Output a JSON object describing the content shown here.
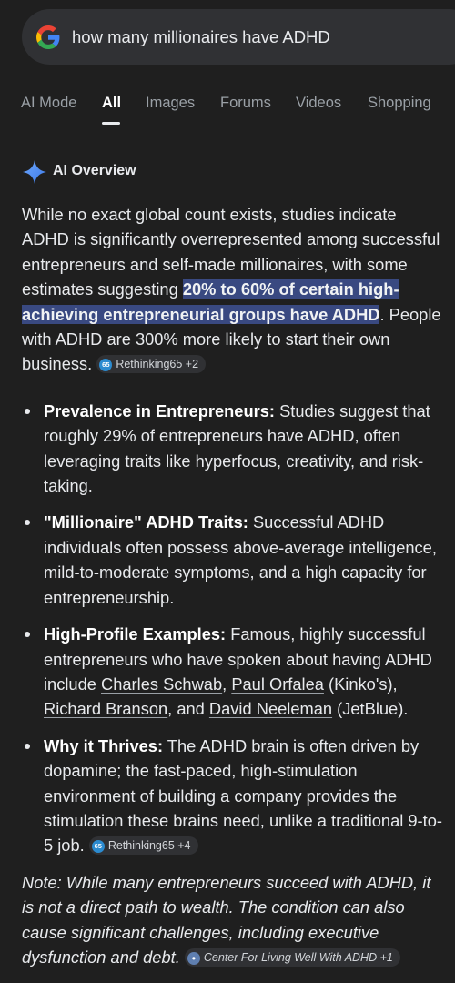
{
  "search": {
    "query": "how many millionaires have ADHD"
  },
  "tabs": [
    "AI Mode",
    "All",
    "Images",
    "Forums",
    "Videos",
    "Shopping"
  ],
  "ai_overview": {
    "title": "AI Overview",
    "intro_1": "While no exact global count exists, studies indicate ADHD is significantly overrepresented among successful entrepreneurs and self-made millionaires, with some estimates suggesting ",
    "intro_highlight": "20% to 60% of certain high-achieving entrepreneurial groups have ADHD",
    "intro_2": ". People with ADHD are 300% more likely to start their own business.",
    "intro_source": {
      "label": "Rethinking65 +2",
      "favicon": "65"
    },
    "bullets": [
      {
        "heading": "Prevalence in Entrepreneurs:",
        "text": " Studies suggest that roughly 29% of entrepreneurs have ADHD, often leveraging traits like hyperfocus, creativity, and risk-taking."
      },
      {
        "heading": "\"Millionaire\" ADHD Traits:",
        "text": " Successful ADHD individuals often possess above-average intelligence, mild-to-moderate symptoms, and a high capacity for entrepreneurship."
      },
      {
        "heading": "High-Profile Examples:",
        "text_1": " Famous, highly successful entrepreneurs who have spoken about having ADHD include ",
        "link_1": "Charles Schwab",
        "sep_1": ", ",
        "link_2": "Paul Orfalea",
        "sep_2": " (Kinko's), ",
        "link_3": "Richard Branson",
        "sep_3": ", and ",
        "link_4": "David Neeleman",
        "text_2": " (JetBlue)."
      },
      {
        "heading": "Why it Thrives:",
        "text": " The ADHD brain is often driven by dopamine; the fast-paced, high-stimulation environment of building a company provides the stimulation these brains need, unlike a traditional 9-to-5 job. ",
        "source": {
          "label": "Rethinking65 +4",
          "favicon": "65"
        }
      }
    ],
    "note": "Note: While many entrepreneurs succeed with ADHD, it is not a direct path to wealth. The condition can also cause significant challenges, including executive dysfunction and debt. ",
    "note_source": {
      "label": "Center For Living Well With ADHD +1"
    }
  },
  "colors": {
    "background": "#1f1f1f",
    "search_bg": "#303134",
    "highlight": "#394981",
    "accent_spark": "#4f8ef7"
  }
}
